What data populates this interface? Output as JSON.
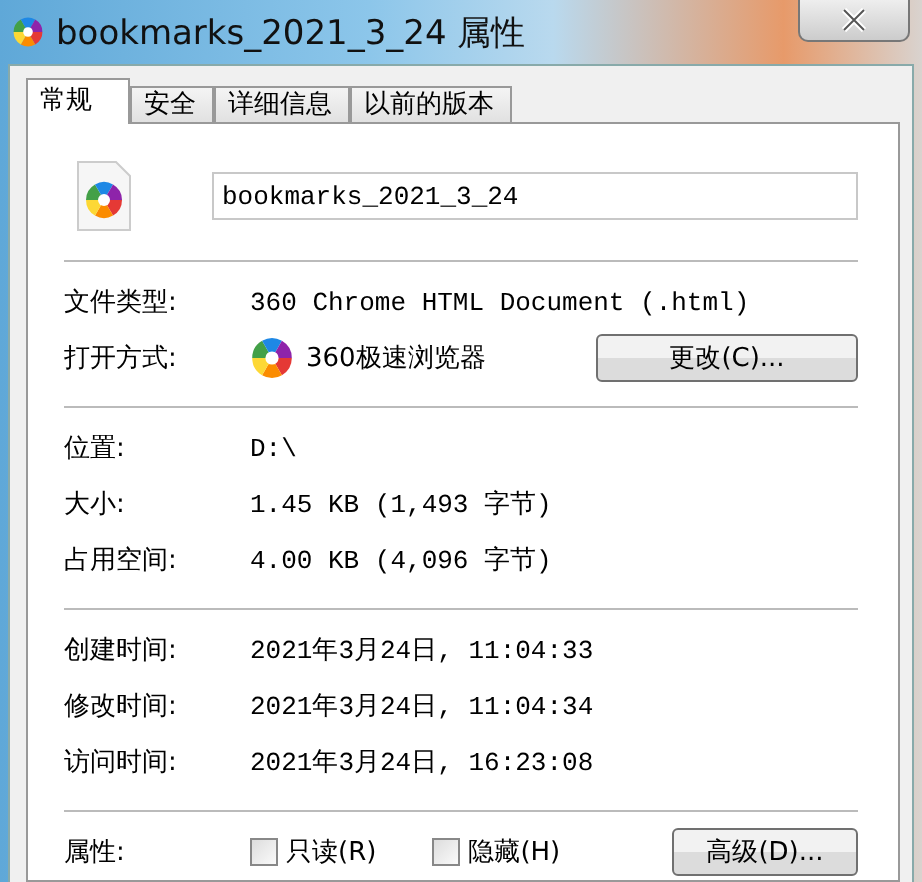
{
  "window": {
    "title": "bookmarks_2021_3_24 属性"
  },
  "tabs": [
    {
      "label": "常规",
      "selected": true
    },
    {
      "label": "安全",
      "selected": false
    },
    {
      "label": "详细信息",
      "selected": false
    },
    {
      "label": "以前的版本",
      "selected": false
    }
  ],
  "file_name": {
    "value": "bookmarks_2021_3_24"
  },
  "sections": [
    [
      {
        "label": "文件类型:",
        "value": "360 Chrome HTML Document (.html)",
        "kind": "text"
      },
      {
        "label": "打开方式:",
        "value": "360极速浏览器",
        "kind": "app",
        "button": "更改(C)..."
      }
    ],
    [
      {
        "label": "位置:",
        "value": "D:\\",
        "kind": "text"
      },
      {
        "label": "大小:",
        "value": "1.45 KB (1,493 字节)",
        "kind": "text"
      },
      {
        "label": "占用空间:",
        "value": "4.00 KB (4,096 字节)",
        "kind": "text"
      }
    ],
    [
      {
        "label": "创建时间:",
        "value": "2021年3月24日, 11:04:33",
        "kind": "text"
      },
      {
        "label": "修改时间:",
        "value": "2021年3月24日, 11:04:34",
        "kind": "text"
      },
      {
        "label": "访问时间:",
        "value": "2021年3月24日, 16:23:08",
        "kind": "text"
      }
    ]
  ],
  "attributes": {
    "label": "属性:",
    "checkboxes": [
      {
        "label": "只读(R)",
        "checked": false
      },
      {
        "label": "隐藏(H)",
        "checked": false
      }
    ],
    "button": "高级(D)..."
  }
}
